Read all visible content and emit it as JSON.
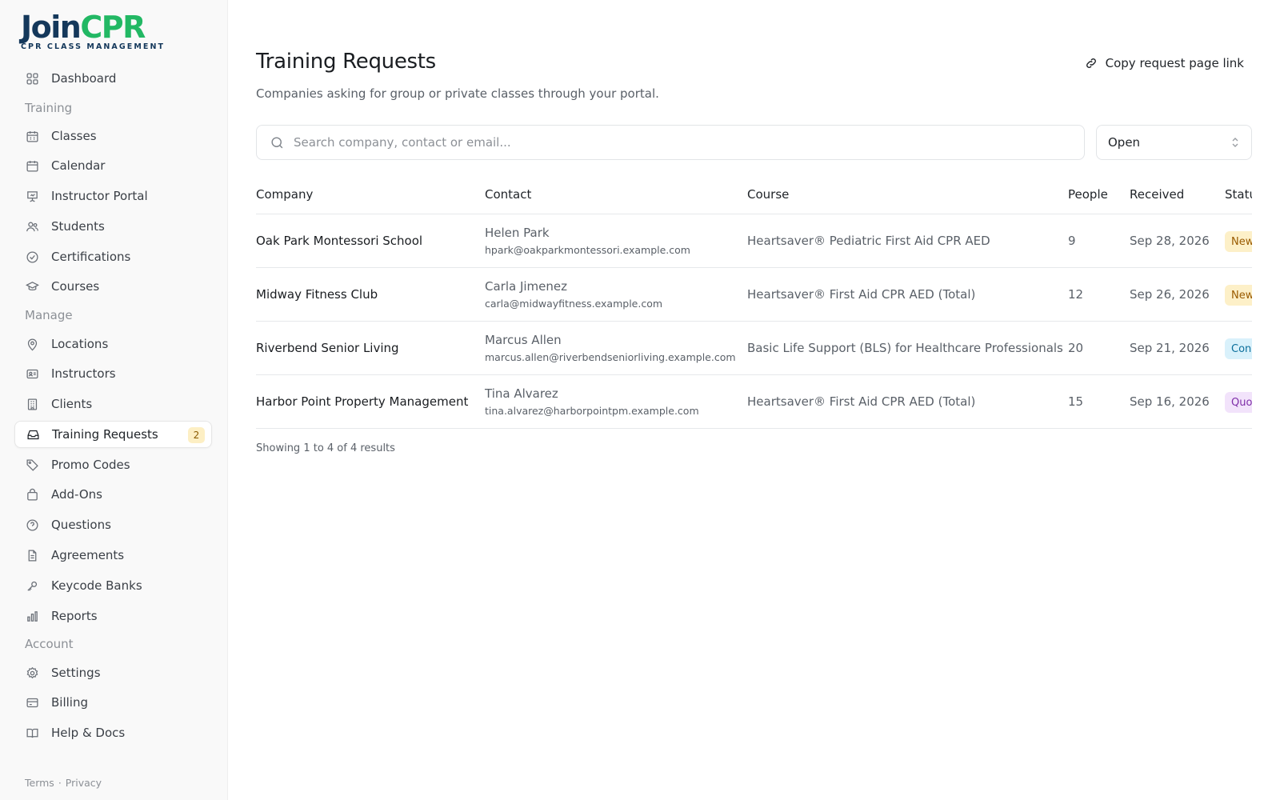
{
  "brand": {
    "name_part1": "Join",
    "name_part2": "CPR",
    "tagline": "CPR CLASS MANAGEMENT"
  },
  "sidebar": {
    "items": [
      {
        "label": "Dashboard",
        "icon": "grid-icon"
      },
      {
        "section": "Training"
      },
      {
        "label": "Classes",
        "icon": "calendar-grid-icon"
      },
      {
        "label": "Calendar",
        "icon": "calendar-icon"
      },
      {
        "label": "Instructor Portal",
        "icon": "presentation-icon"
      },
      {
        "label": "Students",
        "icon": "users-icon"
      },
      {
        "label": "Certifications",
        "icon": "check-circle-icon"
      },
      {
        "label": "Courses",
        "icon": "graduation-cap-icon"
      },
      {
        "section": "Manage"
      },
      {
        "label": "Locations",
        "icon": "map-pin-icon"
      },
      {
        "label": "Instructors",
        "icon": "id-card-icon"
      },
      {
        "label": "Clients",
        "icon": "building-icon"
      },
      {
        "label": "Training Requests",
        "icon": "inbox-icon",
        "badge": "2",
        "active": true
      },
      {
        "label": "Promo Codes",
        "icon": "tag-icon"
      },
      {
        "label": "Add-Ons",
        "icon": "shopping-bag-icon"
      },
      {
        "label": "Questions",
        "icon": "help-circle-icon"
      },
      {
        "label": "Agreements",
        "icon": "file-icon"
      },
      {
        "label": "Keycode Banks",
        "icon": "key-icon"
      },
      {
        "label": "Reports",
        "icon": "bar-chart-icon"
      },
      {
        "section": "Account"
      },
      {
        "label": "Settings",
        "icon": "gear-icon"
      },
      {
        "label": "Billing",
        "icon": "credit-card-icon"
      },
      {
        "label": "Help & Docs",
        "icon": "book-icon"
      }
    ],
    "sections": {
      "training": "Training",
      "manage": "Manage",
      "account": "Account"
    },
    "labels": {
      "dashboard": "Dashboard",
      "classes": "Classes",
      "calendar": "Calendar",
      "instructor_portal": "Instructor Portal",
      "students": "Students",
      "certifications": "Certifications",
      "courses": "Courses",
      "locations": "Locations",
      "instructors": "Instructors",
      "clients": "Clients",
      "training_requests": "Training Requests",
      "training_requests_badge": "2",
      "promo_codes": "Promo Codes",
      "add_ons": "Add-Ons",
      "questions": "Questions",
      "agreements": "Agreements",
      "keycode_banks": "Keycode Banks",
      "reports": "Reports",
      "settings": "Settings",
      "billing": "Billing",
      "help_docs": "Help & Docs"
    },
    "footer": {
      "terms": "Terms",
      "separator": "·",
      "privacy": "Privacy"
    }
  },
  "header": {
    "title": "Training Requests",
    "subtitle": "Companies asking for group or private classes through your portal.",
    "copy_link_label": "Copy request page link"
  },
  "filters": {
    "search_placeholder": "Search company, contact or email...",
    "search_value": "",
    "status_selected": "Open"
  },
  "table": {
    "columns": {
      "company": "Company",
      "contact": "Contact",
      "course": "Course",
      "people": "People",
      "received": "Received",
      "status": "Status"
    },
    "rows": [
      {
        "company": "Oak Park Montessori School",
        "contact_name": "Helen Park",
        "contact_email": "hpark@oakparkmontessori.example.com",
        "course": "Heartsaver® Pediatric First Aid CPR AED",
        "people": "9",
        "received": "Sep 28, 2026",
        "status": "New"
      },
      {
        "company": "Midway Fitness Club",
        "contact_name": "Carla Jimenez",
        "contact_email": "carla@midwayfitness.example.com",
        "course": "Heartsaver® First Aid CPR AED (Total)",
        "people": "12",
        "received": "Sep 26, 2026",
        "status": "New"
      },
      {
        "company": "Riverbend Senior Living",
        "contact_name": "Marcus Allen",
        "contact_email": "marcus.allen@riverbendseniorliving.example.com",
        "course": "Basic Life Support (BLS) for Healthcare Professionals",
        "people": "20",
        "received": "Sep 21, 2026",
        "status": "Con"
      },
      {
        "company": "Harbor Point Property Management",
        "contact_name": "Tina Alvarez",
        "contact_email": "tina.alvarez@harborpointpm.example.com",
        "course": "Heartsaver® First Aid CPR AED (Total)",
        "people": "15",
        "received": "Sep 16, 2026",
        "status": "Quo"
      }
    ],
    "status_colors": {
      "new_bg": "#fdf0c8",
      "new_fg": "#9a5b00",
      "con_bg": "#d9f1fb",
      "con_fg": "#0b6f9c",
      "quo_bg": "#f2e3fb",
      "quo_fg": "#7e2ea8"
    },
    "results_text": "Showing 1 to 4 of 4 results"
  },
  "colors": {
    "brand_navy": "#14385b",
    "brand_green": "#22b864",
    "sidebar_bg": "#f9f9f9"
  }
}
